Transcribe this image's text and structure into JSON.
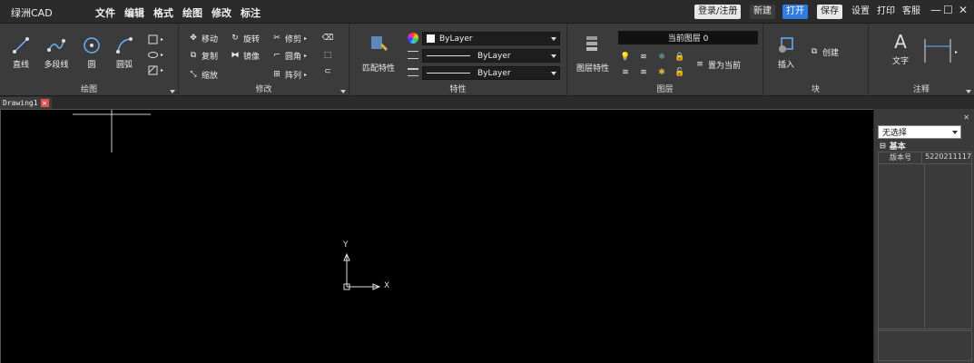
{
  "app": {
    "title": "绿洲CAD"
  },
  "menu": [
    "文件",
    "编辑",
    "格式",
    "绘图",
    "修改",
    "标注"
  ],
  "titlebar": {
    "login": "登录/注册",
    "new": "新建",
    "open": "打开",
    "save": "保存",
    "settings": "设置",
    "print": "打印",
    "support": "客服"
  },
  "ribbon": {
    "draw": {
      "label": "绘图",
      "tools": [
        "直线",
        "多段线",
        "圆",
        "圆弧"
      ]
    },
    "modify": {
      "label": "修改",
      "tools": [
        "移动",
        "旋转",
        "修剪",
        "复制",
        "镜像",
        "圆角",
        "缩放",
        "阵列"
      ]
    },
    "properties": {
      "label": "特性",
      "match": "匹配特性",
      "color": "ByLayer",
      "linetype": "ByLayer",
      "lineweight": "ByLayer"
    },
    "layers": {
      "label": "图层",
      "layer_props": "图层特性",
      "current_layer": "当前图层 0",
      "set_current": "置为当前"
    },
    "block": {
      "label": "块",
      "insert": "插入",
      "create": "创建"
    },
    "annotation": {
      "label": "注释",
      "text": "文字"
    }
  },
  "tab": {
    "name": "Drawing1"
  },
  "axes": {
    "x": "X",
    "y": "Y"
  },
  "properties_panel": {
    "selection": "无选择",
    "group": "基本",
    "rows": [
      {
        "key": "版本号",
        "value": "5220211117"
      }
    ]
  },
  "colors": {
    "accent": "#2f7de1",
    "close_tab": "#e05252"
  }
}
